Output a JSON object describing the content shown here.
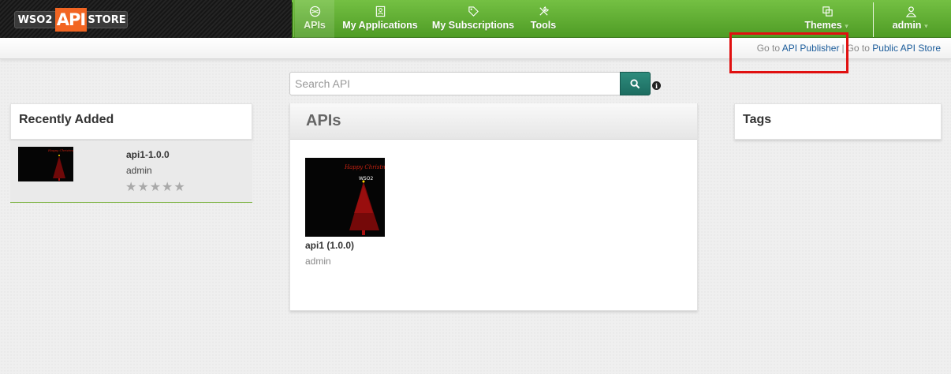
{
  "header": {
    "logo": {
      "wso2": "WSO2",
      "api": "API",
      "store": "STORE"
    },
    "nav": [
      {
        "label": "APIs",
        "icon": "apis-icon",
        "active": true
      },
      {
        "label": "My Applications",
        "icon": "applications-icon"
      },
      {
        "label": "My Subscriptions",
        "icon": "tag-icon"
      },
      {
        "label": "Tools",
        "icon": "tools-icon"
      }
    ],
    "themes_label": "Themes",
    "user_label": "admin"
  },
  "subbar": {
    "goto_prefix_1": "Go to",
    "publisher_link": "API Publisher",
    "separator": "|",
    "goto_prefix_2": "Go to",
    "public_store_link": "Public API Store"
  },
  "search": {
    "placeholder": "Search API",
    "value": ""
  },
  "recently_added": {
    "title": "Recently Added",
    "items": [
      {
        "name": "api1-1.0.0",
        "owner": "admin",
        "rating": 0,
        "max_rating": 5
      }
    ]
  },
  "apis_panel": {
    "title": "APIs",
    "apis": [
      {
        "name": "api1 (1.0.0)",
        "owner": "admin"
      }
    ]
  },
  "tags_panel": {
    "title": "Tags"
  },
  "colors": {
    "nav_green": "#5fae33",
    "link": "#1a5b9a",
    "search_button": "#24776a",
    "highlight": "#e01010"
  }
}
